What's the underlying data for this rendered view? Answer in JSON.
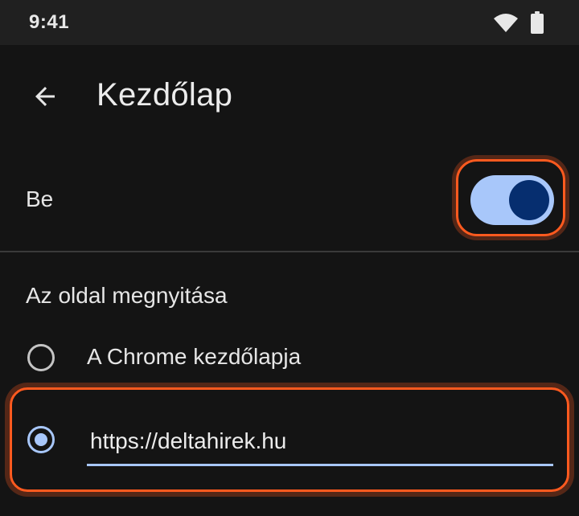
{
  "status_bar": {
    "time": "9:41",
    "icons": [
      "wifi-icon",
      "battery-icon"
    ]
  },
  "app_bar": {
    "back_icon": "arrow-back-icon",
    "title": "Kezdőlap"
  },
  "toggle": {
    "label": "Be",
    "checked": true
  },
  "section": {
    "header": "Az oldal megnyitása",
    "options": [
      {
        "label": "A Chrome kezdőlapja",
        "selected": false
      },
      {
        "value": "https://deltahirek.hu",
        "selected": true
      }
    ]
  },
  "colors": {
    "background": "#141414",
    "status_bar": "#202020",
    "accent": "#a8c7fa",
    "knob": "#062e6f",
    "highlight": "#ff5a1f"
  }
}
